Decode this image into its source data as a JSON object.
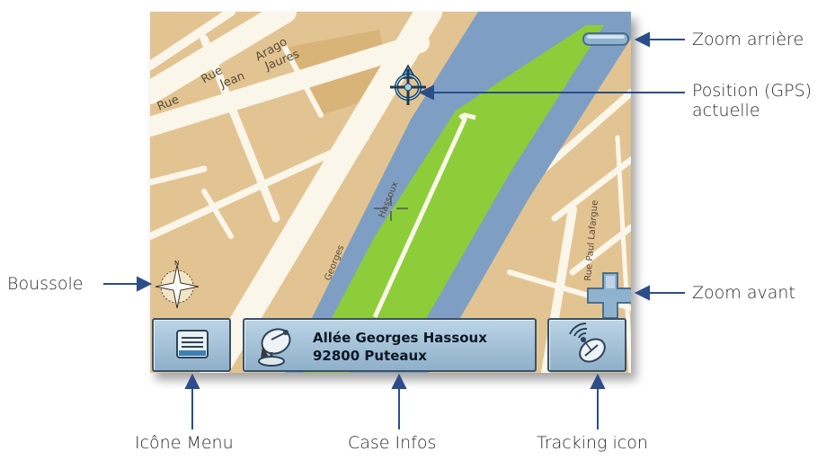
{
  "map": {
    "streets": {
      "rue_top_1": "Rue",
      "rue_top_2": "Arago",
      "jaures_1": "Rue",
      "jaures_2": "Jean",
      "jaures_3": "Jaures",
      "georges_1": "Georges",
      "georges_2": "Hassoux",
      "right_label": "Rue Paul Lafargue",
      "compass_n": "N"
    },
    "colors": {
      "land": "#e2c493",
      "block_dark": "#d9b479",
      "street": "#fbf6ea",
      "river": "#7e9fc3",
      "park": "#8dcd3a"
    }
  },
  "controls": {
    "zoom_out_icon": "minus-icon",
    "zoom_in_icon": "plus-icon",
    "gps_icon": "gps-position-icon",
    "crosshair_icon": "crosshair-icon",
    "compass_icon": "compass-icon"
  },
  "bottom_bar": {
    "menu_icon": "menu-icon",
    "infos_icon": "satellite-dish-icon",
    "infos_line1": "Allée Georges Hassoux",
    "infos_line2": "92800 Puteaux",
    "tracking_icon": "tracking-icon"
  },
  "annotations": {
    "zoom_out": "Zoom arrière",
    "position_line1": "Position (GPS)",
    "position_line2": "actuelle",
    "compass": "Boussole",
    "zoom_in": "Zoom avant",
    "menu": "Icône Menu",
    "infos": "Case Infos",
    "tracking": "Tracking icon"
  }
}
